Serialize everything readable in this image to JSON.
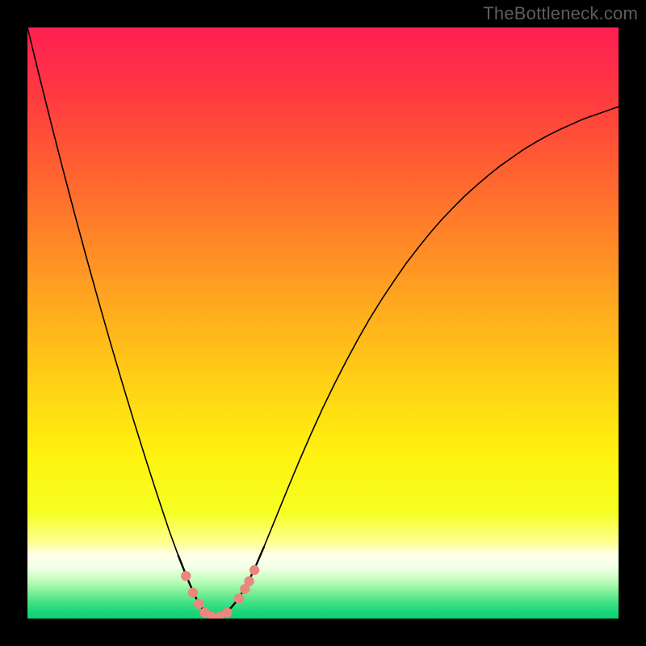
{
  "watermark": "TheBottleneck.com",
  "chart_data": {
    "type": "line",
    "title": "",
    "xlabel": "",
    "ylabel": "",
    "xlim": [
      0,
      1
    ],
    "ylim": [
      0,
      1
    ],
    "x": [
      0.0,
      0.02,
      0.04,
      0.06,
      0.08,
      0.1,
      0.12,
      0.14,
      0.16,
      0.18,
      0.2,
      0.22,
      0.24,
      0.255,
      0.27,
      0.28,
      0.285,
      0.29,
      0.295,
      0.3,
      0.305,
      0.31,
      0.315,
      0.32,
      0.325,
      0.335,
      0.345,
      0.355,
      0.365,
      0.375,
      0.385,
      0.4,
      0.42,
      0.44,
      0.46,
      0.48,
      0.5,
      0.52,
      0.54,
      0.56,
      0.58,
      0.6,
      0.62,
      0.64,
      0.66,
      0.68,
      0.7,
      0.72,
      0.74,
      0.76,
      0.78,
      0.8,
      0.82,
      0.84,
      0.86,
      0.88,
      0.9,
      0.92,
      0.94,
      0.96,
      0.98,
      1.0
    ],
    "y": [
      1.0,
      0.918,
      0.838,
      0.76,
      0.684,
      0.61,
      0.538,
      0.468,
      0.4,
      0.334,
      0.27,
      0.208,
      0.148,
      0.107,
      0.069,
      0.046,
      0.035,
      0.026,
      0.018,
      0.012,
      0.008,
      0.005,
      0.004,
      0.004,
      0.005,
      0.01,
      0.019,
      0.031,
      0.047,
      0.065,
      0.086,
      0.121,
      0.17,
      0.219,
      0.267,
      0.313,
      0.357,
      0.398,
      0.437,
      0.474,
      0.509,
      0.541,
      0.571,
      0.6,
      0.626,
      0.651,
      0.674,
      0.695,
      0.715,
      0.733,
      0.75,
      0.766,
      0.78,
      0.794,
      0.806,
      0.817,
      0.827,
      0.836,
      0.845,
      0.852,
      0.859,
      0.866
    ],
    "annotations": {
      "dots": [
        {
          "x": 0.268,
          "y": 0.072
        },
        {
          "x": 0.28,
          "y": 0.044
        },
        {
          "x": 0.29,
          "y": 0.025
        },
        {
          "x": 0.3,
          "y": 0.01
        },
        {
          "x": 0.312,
          "y": 0.003
        },
        {
          "x": 0.325,
          "y": 0.003
        },
        {
          "x": 0.338,
          "y": 0.01
        },
        {
          "x": 0.358,
          "y": 0.034
        },
        {
          "x": 0.368,
          "y": 0.05
        },
        {
          "x": 0.375,
          "y": 0.063
        },
        {
          "x": 0.384,
          "y": 0.082
        }
      ]
    },
    "gradient_stops": [
      {
        "offset": 0.0,
        "color": "#ff2052"
      },
      {
        "offset": 0.05,
        "color": "#ff2a4c"
      },
      {
        "offset": 0.12,
        "color": "#ff3b3f"
      },
      {
        "offset": 0.22,
        "color": "#ff5a33"
      },
      {
        "offset": 0.35,
        "color": "#ff8328"
      },
      {
        "offset": 0.48,
        "color": "#ffac1e"
      },
      {
        "offset": 0.6,
        "color": "#ffd015"
      },
      {
        "offset": 0.72,
        "color": "#fff20f"
      },
      {
        "offset": 0.82,
        "color": "#f6ff22"
      },
      {
        "offset": 0.872,
        "color": "#feff94"
      },
      {
        "offset": 0.892,
        "color": "#ffffe8"
      },
      {
        "offset": 0.912,
        "color": "#f5ffe8"
      },
      {
        "offset": 0.926,
        "color": "#d8ffce"
      },
      {
        "offset": 0.942,
        "color": "#aef9b0"
      },
      {
        "offset": 0.958,
        "color": "#73ee94"
      },
      {
        "offset": 0.975,
        "color": "#3de083"
      },
      {
        "offset": 0.99,
        "color": "#18d57a"
      },
      {
        "offset": 1.0,
        "color": "#0cd078"
      }
    ]
  }
}
